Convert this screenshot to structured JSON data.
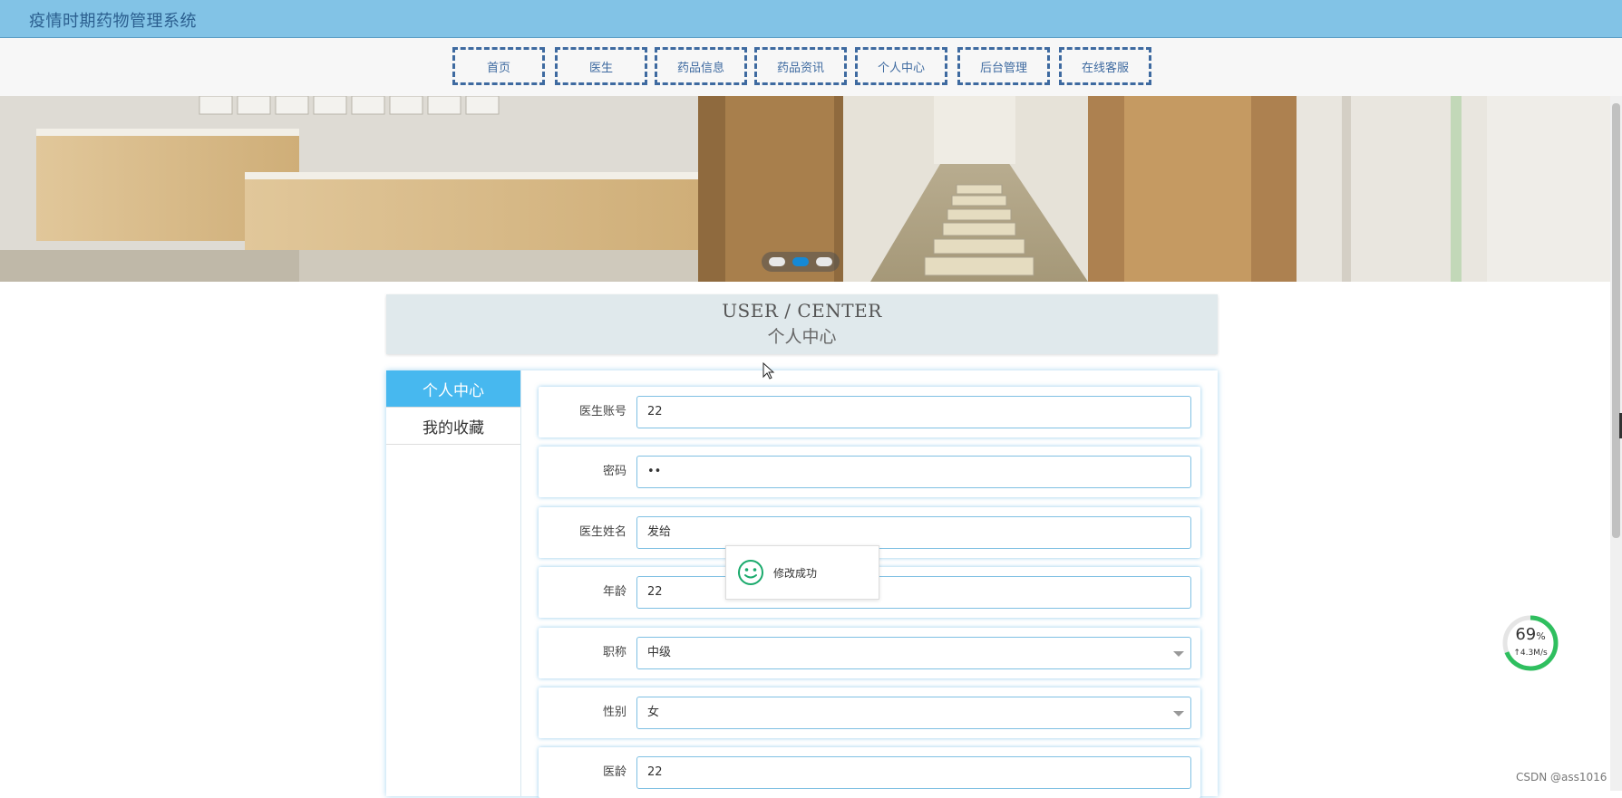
{
  "app": {
    "title": "疫情时期药物管理系统"
  },
  "nav": {
    "items": [
      "首页",
      "医生",
      "药品信息",
      "药品资讯",
      "个人中心",
      "后台管理",
      "在线客服"
    ]
  },
  "banner": {
    "slides": 3,
    "active_slide": 2
  },
  "section": {
    "title_en": "USER / CENTER",
    "title_zh": "个人中心"
  },
  "sidebar": {
    "items": [
      {
        "label": "个人中心",
        "active": true
      },
      {
        "label": "我的收藏",
        "active": false
      }
    ]
  },
  "form": {
    "fields": [
      {
        "label": "医生账号",
        "value": "22",
        "type": "text"
      },
      {
        "label": "密码",
        "value": "••",
        "type": "password"
      },
      {
        "label": "医生姓名",
        "value": "发给",
        "type": "text"
      },
      {
        "label": "年龄",
        "value": "22",
        "type": "text"
      },
      {
        "label": "职称",
        "value": "中级",
        "type": "select"
      },
      {
        "label": "性别",
        "value": "女",
        "type": "select"
      },
      {
        "label": "医龄",
        "value": "22",
        "type": "text"
      }
    ]
  },
  "toast": {
    "message": "修改成功",
    "icon": "smile-icon"
  },
  "speed_widget": {
    "percent": "69",
    "percent_unit": "%",
    "rate": "↑4.3M/s"
  },
  "watermark": "CSDN @ass1016",
  "colors": {
    "topbar": "#82c3e6",
    "nav_border": "#3e6aa0",
    "accent": "#47b8ef",
    "toast_icon": "#1aaa6c"
  }
}
